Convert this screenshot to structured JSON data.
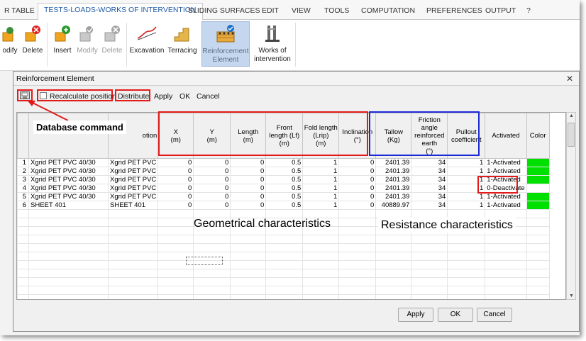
{
  "tabs": [
    "R TABLE",
    "TESTS-LOADS-WORKS OF INTERVENTION",
    "SLIDING SURFACES",
    "EDIT",
    "VIEW",
    "TOOLS",
    "COMPUTATION",
    "PREFERENCES",
    "OUTPUT",
    "?"
  ],
  "ribbon": {
    "buttons": [
      "odify",
      "Delete",
      "Insert",
      "Modify",
      "Delete",
      "Excavation",
      "Terracing",
      "Reinforcement Element",
      "Works of intervention"
    ],
    "reinforcement_lines": [
      "Reinforcement",
      "Element"
    ],
    "works_lines": [
      "Works of",
      "intervention"
    ]
  },
  "dialog": {
    "title": "Reinforcement Element",
    "close": "✕",
    "toolbar": {
      "recalculate": "Recalculate position",
      "distribute": "Distribute",
      "apply": "Apply",
      "ok": "OK",
      "cancel": "Cancel"
    },
    "buttons": {
      "apply": "Apply",
      "ok": "OK",
      "cancel": "Cancel"
    }
  },
  "table": {
    "headers": {
      "col0": "",
      "type": "",
      "desc": "otion",
      "x": "X\n(m)",
      "y": "Y\n(m)",
      "length": "Length\n(m)",
      "front": "Front\nlength (Lf)\n(m)",
      "fold": "Fold length\n(Lrip)\n(m)",
      "incl": "Inclination\n(°)",
      "tallow": "Tallow\n(Kg)",
      "friction": "Friction\nangle\nreinforced\nearth\n(°)",
      "pullout": "Pullout\ncoefficient",
      "activated": "Activated",
      "color": "Color"
    },
    "rows": [
      {
        "n": "1",
        "type": "Xgrid PET PVC 40/30",
        "desc": "Xgrid PET PVC",
        "x": "0",
        "y": "0",
        "len": "0",
        "front": "0.5",
        "fold": "1",
        "incl": "0",
        "tallow": "2401.39",
        "fric": "34",
        "pull": "1",
        "act": "1-Activated",
        "color": "#00e000"
      },
      {
        "n": "2",
        "type": "Xgrid PET PVC 40/30",
        "desc": "Xgrid PET PVC",
        "x": "0",
        "y": "0",
        "len": "0",
        "front": "0.5",
        "fold": "1",
        "incl": "0",
        "tallow": "2401.39",
        "fric": "34",
        "pull": "1",
        "act": "1-Activated",
        "color": "#00e000"
      },
      {
        "n": "3",
        "type": "Xgrid PET PVC 40/30",
        "desc": "Xgrid PET PVC",
        "x": "0",
        "y": "0",
        "len": "0",
        "front": "0.5",
        "fold": "1",
        "incl": "0",
        "tallow": "2401.39",
        "fric": "34",
        "pull": "1",
        "act": "1-Activated",
        "color": "#00e000"
      },
      {
        "n": "4",
        "type": "Xgrid PET PVC 40/30",
        "desc": "Xgrid PET PVC",
        "x": "0",
        "y": "0",
        "len": "0",
        "front": "0.5",
        "fold": "1",
        "incl": "0",
        "tallow": "2401.39",
        "fric": "34",
        "pull": "1",
        "act": "0-Deactivate",
        "color": "#ffffff"
      },
      {
        "n": "5",
        "type": "Xgrid PET PVC 40/30",
        "desc": "Xgrid PET PVC",
        "x": "0",
        "y": "0",
        "len": "0",
        "front": "0.5",
        "fold": "1",
        "incl": "0",
        "tallow": "2401.39",
        "fric": "34",
        "pull": "1",
        "act": "1-Activated",
        "color": "#00e000"
      },
      {
        "n": "6",
        "type": "SHEET 401",
        "desc": "SHEET 401",
        "x": "0",
        "y": "0",
        "len": "0",
        "front": "0.5",
        "fold": "1",
        "incl": "0",
        "tallow": "40889.97",
        "fric": "34",
        "pull": "1",
        "act": "1-Activated",
        "color": "#00e000"
      }
    ]
  },
  "annotations": {
    "database": "Database command",
    "geometrical": "Geometrical characteristics",
    "resistance": "Resistance characteristics"
  },
  "colors": {
    "annotation_red": "#e21a1a",
    "annotation_blue": "#1b2ad6",
    "activated_green": "#00e000",
    "active_tab_text": "#1f5aa6"
  },
  "icons": [
    "modify-icon",
    "delete-icon",
    "insert-icon",
    "modify-icon",
    "delete-icon",
    "excavation-icon",
    "terracing-icon",
    "reinforcement-element-icon",
    "works-of-intervention-icon",
    "database-icon",
    "close-icon",
    "checkbox-icon"
  ]
}
